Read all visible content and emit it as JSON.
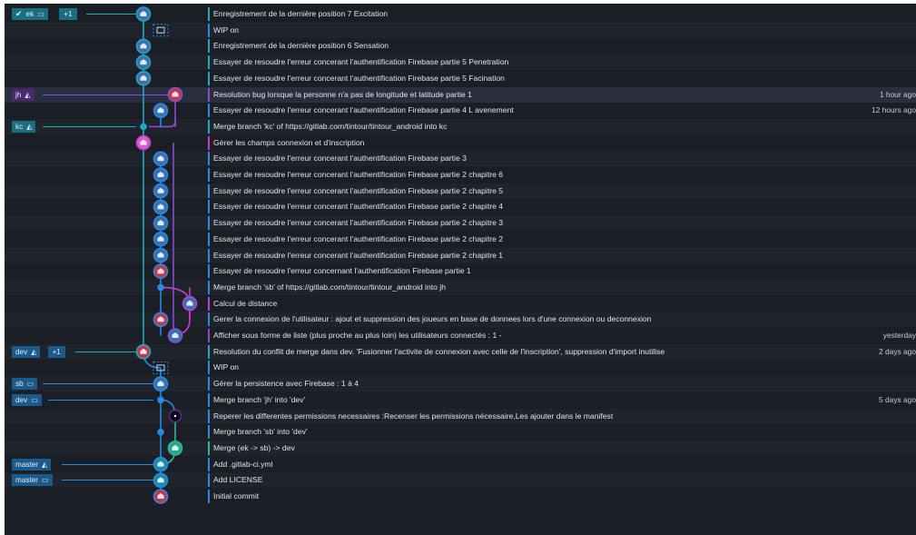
{
  "colors": {
    "background": "#1b1e25",
    "row_stripe": "#1f232b",
    "teal": "#1ea8c4",
    "blue": "#2589e6",
    "magenta": "#c63bd1",
    "purple": "#8a4ed0",
    "highlight_jh": "#2a2f40"
  },
  "lanes": {
    "teal": 153,
    "purple": 188,
    "magenta_kc": 186,
    "magenta": 204,
    "blue": 172,
    "green": 188,
    "red_node": 158
  },
  "commits": [
    {
      "message": "Enregistrement de la dernière position 7 Excitation",
      "time": "",
      "lane": "teal",
      "node": "avatar",
      "color": "#1ea8c4",
      "refs": [
        {
          "label": "ek",
          "icon": "laptop-icon",
          "check": true,
          "color": "#1b6e82"
        }
      ],
      "plus": "+1"
    },
    {
      "message": "WIP on",
      "time": "",
      "lane": "blue",
      "node": "wip",
      "color": "#2589e6",
      "refs": []
    },
    {
      "message": "Enregistrement de la dernière position 6 Sensation",
      "time": "",
      "lane": "teal",
      "node": "avatar",
      "color": "#1ea8c4",
      "refs": []
    },
    {
      "message": "Essayer de resoudre l'erreur concerant l'authentification Firebase partie 5 Penetration",
      "time": "",
      "lane": "teal",
      "node": "avatar",
      "color": "#1ea8c4",
      "refs": []
    },
    {
      "message": "Essayer de resoudre l'erreur concerant l'authentification Firebase partie 5 Facination",
      "time": "",
      "lane": "teal",
      "node": "avatar",
      "color": "#1ea8c4",
      "refs": []
    },
    {
      "message": "Resolution bug lorsque la personne n'a pas de longitude et latitude partie 1",
      "time": "1 hour ago",
      "lane": "purple",
      "node": "avatar-red",
      "color": "#8a4ed0",
      "refs": [
        {
          "label": "jh",
          "icon": "gitlab-icon",
          "check": false,
          "color": "#4a2a6e"
        }
      ],
      "highlight": true
    },
    {
      "message": "Essayer de resoudre l'erreur concerant l'authentification Firebase partie 4 L avenement",
      "time": "12 hours ago",
      "lane": "blue",
      "node": "avatar",
      "color": "#2589e6",
      "refs": []
    },
    {
      "message": "Merge branch 'kc' of https://gitlab.com/tintour/tintour_android into kc",
      "time": "",
      "lane": "teal",
      "node": "dot",
      "color": "#1ea8c4",
      "refs": [
        {
          "label": "kc",
          "icon": "gitlab-icon",
          "check": false,
          "color": "#1b6e82"
        }
      ]
    },
    {
      "message": "Gérer les champs connexion et d'inscription",
      "time": "",
      "lane": "teal",
      "node": "avatar-pink",
      "color": "#c63bd1",
      "refs": []
    },
    {
      "message": "Essayer de resoudre l'erreur concerant l'authentification Firebase partie 3",
      "time": "",
      "lane": "blue",
      "node": "avatar",
      "color": "#2589e6",
      "refs": []
    },
    {
      "message": "Essayer de resoudre l'erreur concerant l'authentification Firebase partie 2 chapitre 6",
      "time": "",
      "lane": "blue",
      "node": "avatar",
      "color": "#2589e6",
      "refs": []
    },
    {
      "message": "Essayer de resoudre l'erreur concerant l'authentification Firebase partie 2 chapitre 5",
      "time": "",
      "lane": "blue",
      "node": "avatar",
      "color": "#2589e6",
      "refs": []
    },
    {
      "message": "Essayer de resoudre l'erreur concerant l'authentification Firebase partie 2 chapitre 4",
      "time": "",
      "lane": "blue",
      "node": "avatar",
      "color": "#2589e6",
      "refs": []
    },
    {
      "message": "Essayer de resoudre l'erreur concerant l'authentification Firebase partie 2 chapitre 3",
      "time": "",
      "lane": "blue",
      "node": "avatar",
      "color": "#2589e6",
      "refs": []
    },
    {
      "message": "Essayer de resoudre l'erreur concerant l'authentification Firebase partie 2 chapitre 2",
      "time": "",
      "lane": "blue",
      "node": "avatar",
      "color": "#2589e6",
      "refs": []
    },
    {
      "message": "Essayer de resoudre l'erreur concerant l'authentification Firebase partie 2 chapitre 1",
      "time": "",
      "lane": "blue",
      "node": "avatar",
      "color": "#2589e6",
      "refs": []
    },
    {
      "message": "Essayer de resoudre l'erreur concernant l'authentification Firebase partie 1",
      "time": "",
      "lane": "blue",
      "node": "avatar-red",
      "color": "#2589e6",
      "refs": []
    },
    {
      "message": "Merge branch 'sb' of https://gitlab.com/tintour/tintour_android into jh",
      "time": "",
      "lane": "blue",
      "node": "dot",
      "color": "#2589e6",
      "refs": []
    },
    {
      "message": "Calcul de distance",
      "time": "",
      "lane": "magenta",
      "node": "avatar",
      "color": "#c63bd1",
      "refs": []
    },
    {
      "message": "Gerer la connexion de l'utilisateur : ajout et suppression des joueurs en base de donnees lors d'une connexion ou deconnexion",
      "time": "",
      "lane": "blue",
      "node": "avatar-red",
      "color": "#2589e6",
      "refs": []
    },
    {
      "message": "Afficher sous forme de liste (plus proche au plus loin) les utilisateurs connectés : 1 -",
      "time": "yesterday",
      "lane": "purple",
      "node": "avatar",
      "color": "#8a4ed0",
      "refs": []
    },
    {
      "message": "Resolution du conflit de merge dans dev. 'Fusionner l'activite de connexion avec celle de l'inscription', suppression d'import inutilise",
      "time": "2 days ago",
      "lane": "teal",
      "node": "avatar-red",
      "color": "#1ea8c4",
      "refs": [
        {
          "label": "dev",
          "icon": "gitlab-icon",
          "check": false,
          "color": "#1a5a8c"
        }
      ],
      "plus": "+1"
    },
    {
      "message": "WIP on",
      "time": "",
      "lane": "blue",
      "node": "wip",
      "color": "#2589e6",
      "refs": []
    },
    {
      "message": "Gérer la persistence avec Firebase : 1 à 4",
      "time": "",
      "lane": "blue",
      "node": "avatar",
      "color": "#2589e6",
      "refs": [
        {
          "label": "sb",
          "icon": "laptop-icon",
          "check": false,
          "color": "#1a5a8c"
        }
      ]
    },
    {
      "message": "Merge branch 'jh' into 'dev'",
      "time": "5 days ago",
      "lane": "blue",
      "node": "dot",
      "color": "#2589e6",
      "refs": [
        {
          "label": "dev",
          "icon": "laptop-icon",
          "check": false,
          "color": "#1a5a8c"
        }
      ]
    },
    {
      "message": "Reperer les differentes permissions necessaires :Recenser les permissions nécessaire,Les ajouter dans le manifest",
      "time": "",
      "lane": "green",
      "node": "dark",
      "color": "#2589e6",
      "refs": []
    },
    {
      "message": "Merge branch 'sb' into 'dev'",
      "time": "",
      "lane": "blue",
      "node": "dot",
      "color": "#2589e6",
      "refs": []
    },
    {
      "message": "Merge (ek -> sb) -> dev",
      "time": "",
      "lane": "green",
      "node": "avatar-green",
      "color": "#2db8a0",
      "refs": []
    },
    {
      "message": "Add .gitlab-ci.yml",
      "time": "",
      "lane": "blue",
      "node": "avatar-teal",
      "color": "#2589e6",
      "refs": [
        {
          "label": "master",
          "icon": "gitlab-icon",
          "check": false,
          "color": "#1a5a8c"
        }
      ]
    },
    {
      "message": "Add LICENSE",
      "time": "",
      "lane": "blue",
      "node": "avatar-teal",
      "color": "#2589e6",
      "refs": [
        {
          "label": "master",
          "icon": "laptop-icon",
          "check": false,
          "color": "#1a5a8c"
        }
      ]
    },
    {
      "message": "Initial commit",
      "time": "",
      "lane": "blue",
      "node": "avatar-red",
      "color": "#2589e6",
      "refs": []
    }
  ]
}
